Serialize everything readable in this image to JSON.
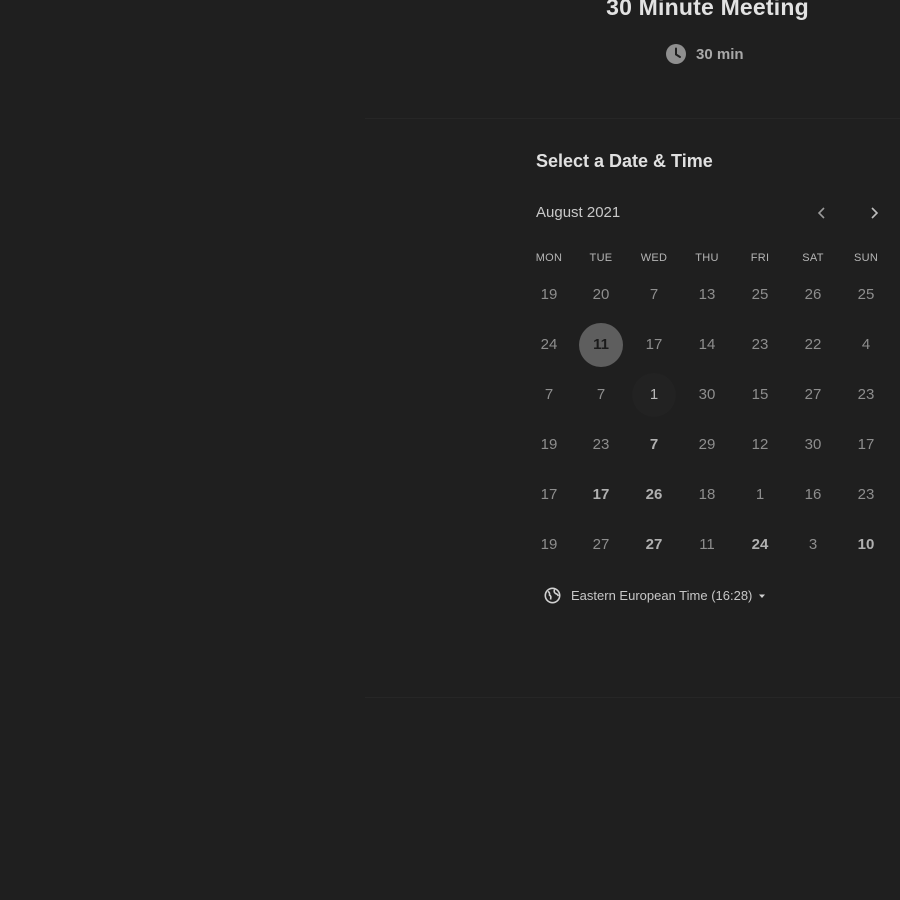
{
  "event": {
    "title": "30 Minute Meeting",
    "duration": "30 min",
    "duration_icon": "clock-icon"
  },
  "scheduler": {
    "heading": "Select a Date & Time",
    "month": "August 2021",
    "prev_icon": "chevron-left-icon",
    "next_icon": "chevron-right-icon",
    "weekdays": [
      "MON",
      "TUE",
      "WED",
      "THU",
      "FRI",
      "SAT",
      "SUN"
    ],
    "weeks": [
      [
        {
          "label": "19",
          "state": "disabled"
        },
        {
          "label": "20",
          "state": "disabled"
        },
        {
          "label": "7",
          "state": "disabled"
        },
        {
          "label": "13",
          "state": "disabled"
        },
        {
          "label": "25",
          "state": "disabled"
        },
        {
          "label": "26",
          "state": "disabled"
        },
        {
          "label": "25",
          "state": "disabled"
        }
      ],
      [
        {
          "label": "24",
          "state": "disabled"
        },
        {
          "label": "11",
          "state": "selected"
        },
        {
          "label": "17",
          "state": "disabled"
        },
        {
          "label": "14",
          "state": "disabled"
        },
        {
          "label": "23",
          "state": "disabled"
        },
        {
          "label": "22",
          "state": "disabled"
        },
        {
          "label": "4",
          "state": "disabled"
        }
      ],
      [
        {
          "label": "7",
          "state": "disabled"
        },
        {
          "label": "7",
          "state": "disabled"
        },
        {
          "label": "1",
          "state": "today"
        },
        {
          "label": "30",
          "state": "disabled"
        },
        {
          "label": "15",
          "state": "disabled"
        },
        {
          "label": "27",
          "state": "disabled"
        },
        {
          "label": "23",
          "state": "disabled"
        }
      ],
      [
        {
          "label": "19",
          "state": "disabled"
        },
        {
          "label": "23",
          "state": "disabled"
        },
        {
          "label": "7",
          "state": "available"
        },
        {
          "label": "29",
          "state": "disabled"
        },
        {
          "label": "12",
          "state": "disabled"
        },
        {
          "label": "30",
          "state": "disabled"
        },
        {
          "label": "17",
          "state": "disabled"
        }
      ],
      [
        {
          "label": "17",
          "state": "disabled"
        },
        {
          "label": "17",
          "state": "available"
        },
        {
          "label": "26",
          "state": "available"
        },
        {
          "label": "18",
          "state": "disabled"
        },
        {
          "label": "1",
          "state": "disabled"
        },
        {
          "label": "16",
          "state": "disabled"
        },
        {
          "label": "23",
          "state": "disabled"
        }
      ],
      [
        {
          "label": "19",
          "state": "disabled"
        },
        {
          "label": "27",
          "state": "disabled"
        },
        {
          "label": "27",
          "state": "available"
        },
        {
          "label": "11",
          "state": "disabled"
        },
        {
          "label": "24",
          "state": "available"
        },
        {
          "label": "3",
          "state": "disabled"
        },
        {
          "label": "10",
          "state": "available"
        }
      ]
    ],
    "timezone": {
      "label": "Eastern European Time (16:28)",
      "icon": "globe-icon",
      "dropdown_icon": "caret-down-icon"
    }
  },
  "colors": {
    "background": "#1f1f1f",
    "selected_day": "#5e5e5e",
    "text_primary": "#e0e0e0",
    "text_muted": "#8e8e8e"
  }
}
